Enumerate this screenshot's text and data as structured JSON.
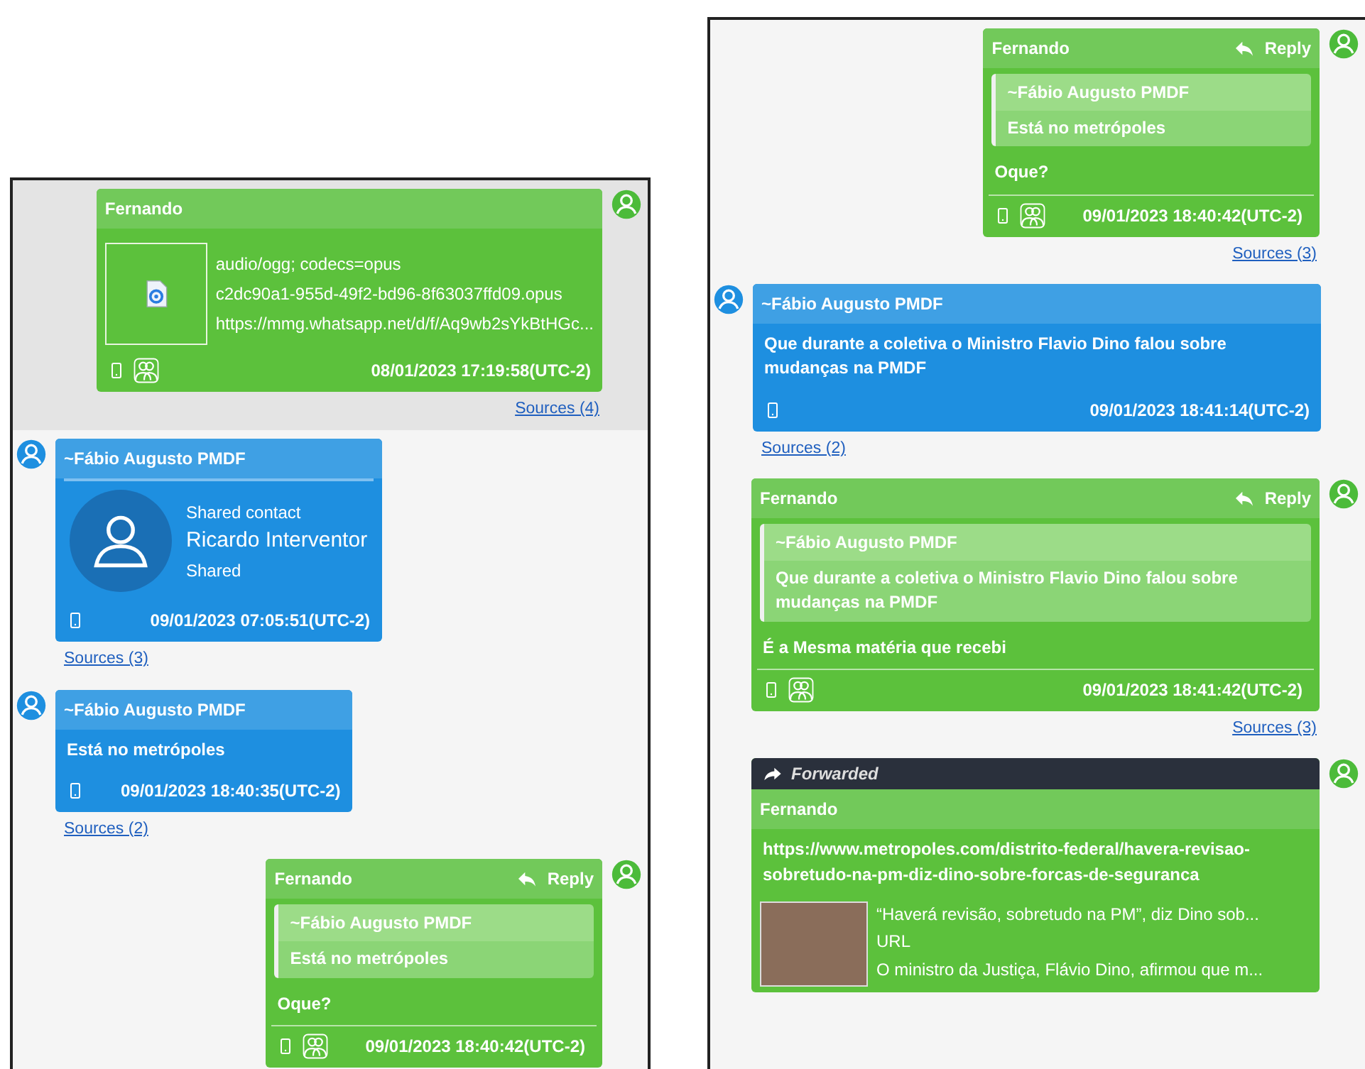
{
  "panels": [
    {
      "messages": [
        {
          "kind": "outgoing",
          "selected": true,
          "sender": "Fernando",
          "attachment": {
            "lines": [
              "audio/ogg; codecs=opus",
              "c2dc90a1-955d-49f2-bd96-8f63037ffd09.opus",
              "https://mmg.whatsapp.net/d/f/Aq9wb2sYkBtHGc..."
            ]
          },
          "timestamp": "08/01/2023 17:19:58(UTC-2)",
          "sources": "Sources (4)"
        },
        {
          "kind": "incoming",
          "selected": false,
          "sender": "~Fábio Augusto PMDF",
          "contact": {
            "caption": "Shared contact",
            "name": "Ricardo Interventor",
            "status": "Shared"
          },
          "timestamp": "09/01/2023 07:05:51(UTC-2)",
          "sources": "Sources (3)"
        },
        {
          "kind": "incoming",
          "selected": false,
          "sender": "~Fábio Augusto PMDF",
          "body": "Está no metrópoles",
          "timestamp": "09/01/2023 18:40:35(UTC-2)",
          "sources": "Sources (2)"
        },
        {
          "kind": "outgoing",
          "selected": false,
          "sender": "Fernando",
          "reply": "Reply",
          "quote": {
            "sender": "~Fábio Augusto PMDF",
            "text": "Está no metrópoles"
          },
          "body": "Oque?",
          "timestamp": "09/01/2023 18:40:42(UTC-2)"
        }
      ]
    },
    {
      "messages": [
        {
          "kind": "outgoing",
          "selected": false,
          "sender": "Fernando",
          "reply": "Reply",
          "quote": {
            "sender": "~Fábio Augusto PMDF",
            "text": "Está no metrópoles"
          },
          "body": "Oque?",
          "timestamp": "09/01/2023 18:40:42(UTC-2)",
          "sources": "Sources (3)"
        },
        {
          "kind": "incoming",
          "selected": false,
          "sender": "~Fábio Augusto PMDF",
          "body": "Que durante a coletiva o Ministro Flavio Dino falou sobre mudanças na PMDF",
          "timestamp": "09/01/2023 18:41:14(UTC-2)",
          "sources": "Sources (2)"
        },
        {
          "kind": "outgoing",
          "selected": false,
          "sender": "Fernando",
          "reply": "Reply",
          "quote": {
            "sender": "~Fábio Augusto PMDF",
            "text": "Que durante a coletiva o Ministro Flavio Dino falou sobre mudanças na PMDF"
          },
          "body": "É a Mesma matéria que recebi",
          "timestamp": "09/01/2023 18:41:42(UTC-2)",
          "sources": "Sources (3)"
        },
        {
          "kind": "outgoing",
          "selected": false,
          "forwarded": "Forwarded",
          "sender": "Fernando",
          "body": "https://www.metropoles.com/distrito-federal/havera-revisao-sobretudo-na-pm-diz-dino-sobre-forcas-de-seguranca",
          "link_preview": {
            "title": "“Haverá revisão, sobretudo na PM”, diz Dino sob...",
            "kind": "URL",
            "description": "O ministro da Justiça, Flávio Dino, afirmou que m..."
          }
        }
      ]
    }
  ]
}
